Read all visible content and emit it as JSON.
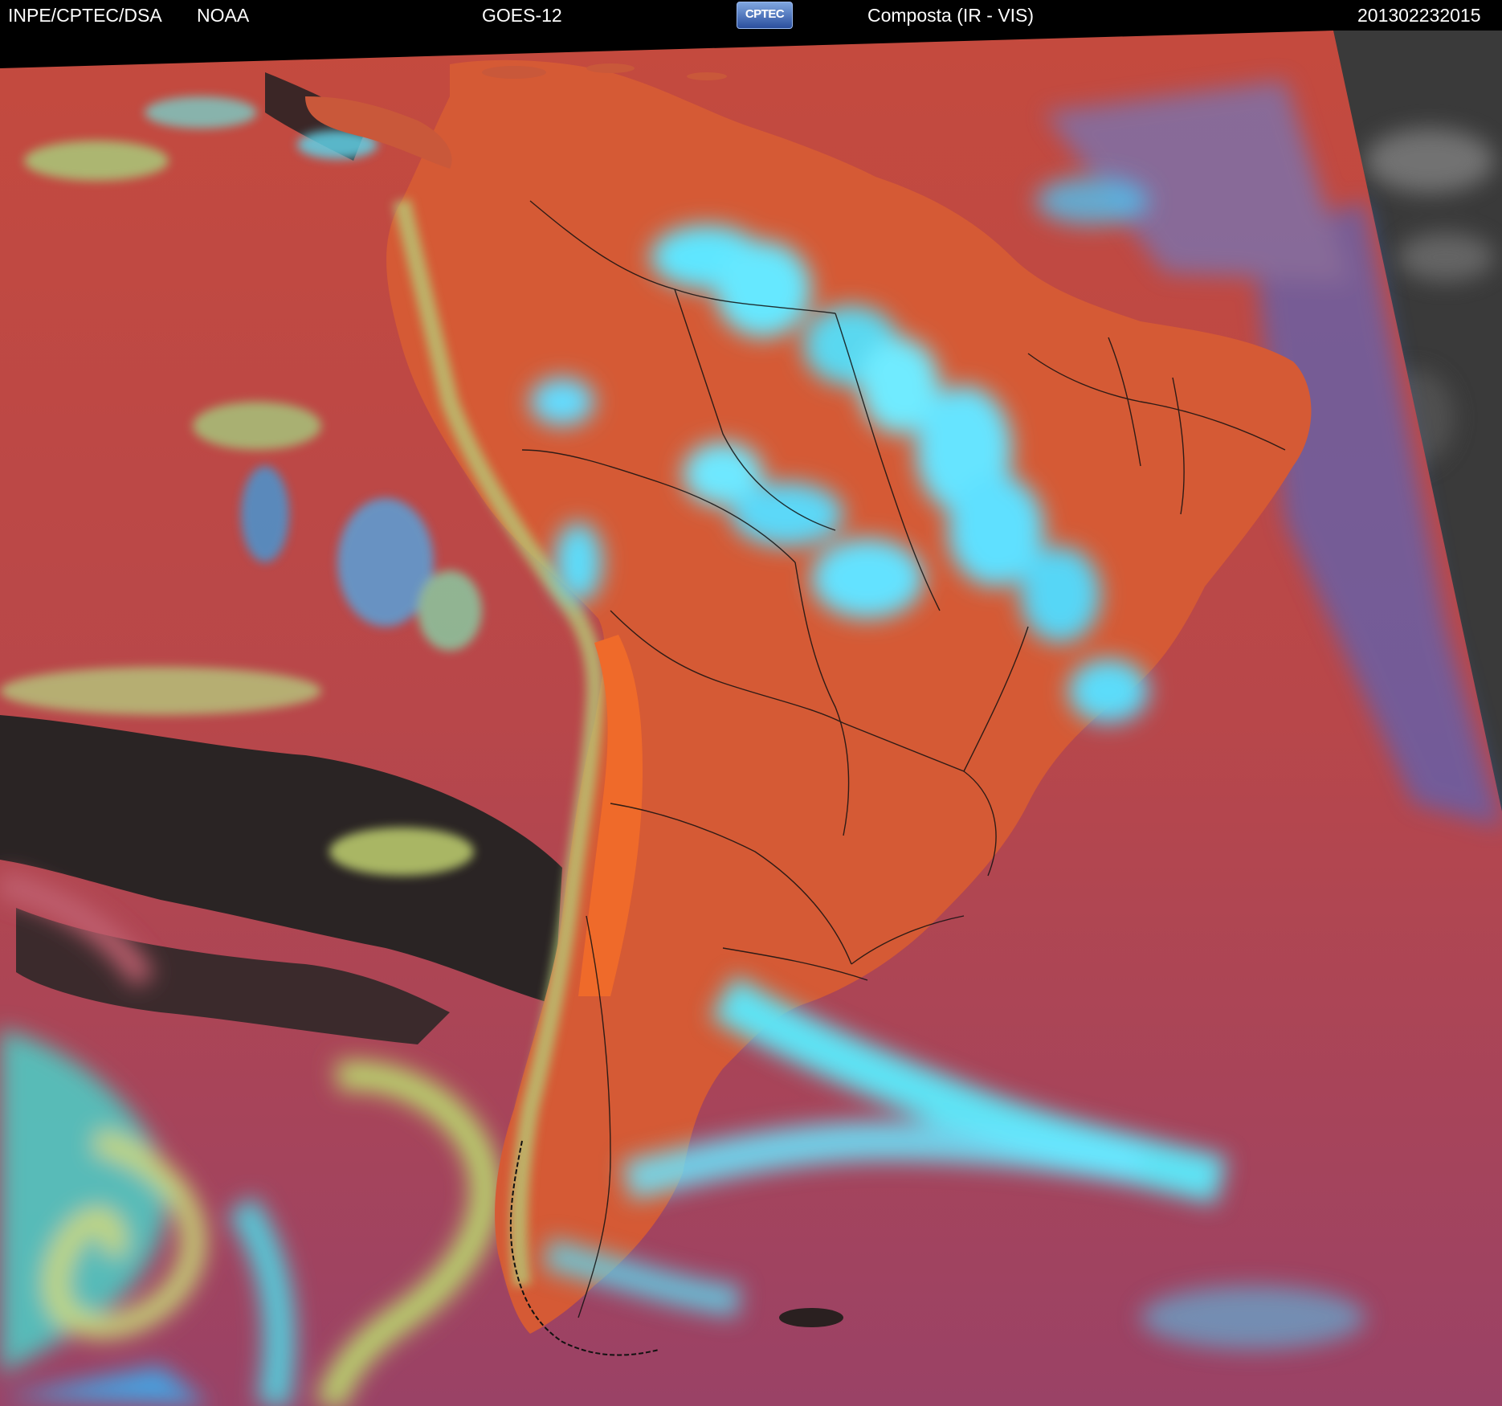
{
  "header": {
    "agency": "INPE/CPTEC/DSA",
    "partner": "NOAA",
    "satellite": "GOES-12",
    "logo_text": "CPTEC",
    "product": "Composta (IR - VIS)",
    "timestamp": "201302232015"
  },
  "map": {
    "region": "South America",
    "colors": {
      "ocean": "#b8474a",
      "land": "#d55a35",
      "cloud_high": "#45e6ff",
      "cloud_mid": "#8fd6b0",
      "cloud_low": "#c9d66a",
      "clear_sky": "#2a2424",
      "night_side": "#3c3c3c",
      "borders": "#111111"
    },
    "icons": [
      "cptec-logo-icon"
    ]
  }
}
